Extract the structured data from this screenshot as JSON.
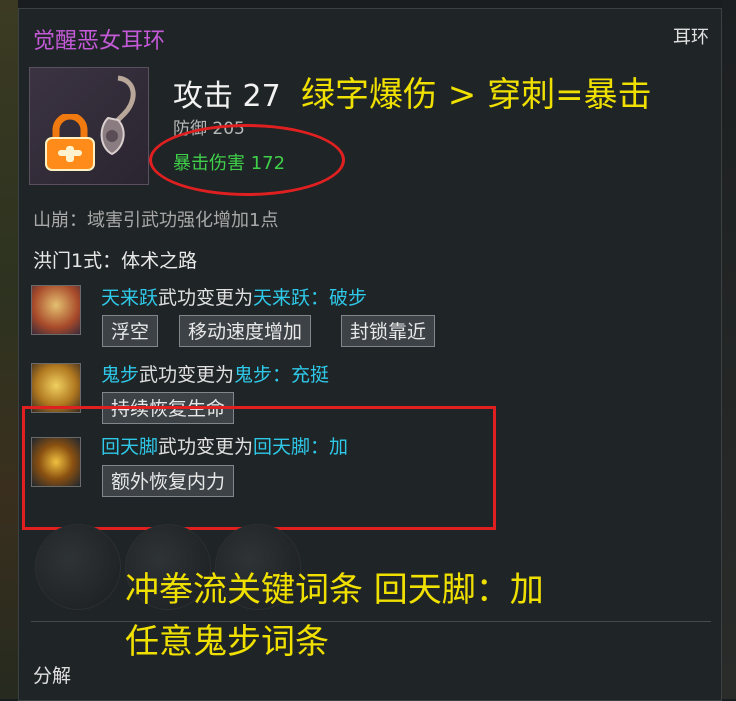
{
  "item": {
    "name": "觉醒恶女耳环",
    "slot": "耳环",
    "attack": "攻击 27",
    "defense": "防御 205",
    "crit_damage": "暴击伤害 172",
    "passive": "山崩：域害引武功强化增加1点",
    "school_style": "洪门1式：体术之路"
  },
  "skills": [
    {
      "name": "天来跃",
      "middle": "武功变更为",
      "changed": "天来跃：破步",
      "tags": [
        "浮空",
        "移动速度增加",
        "封锁靠近"
      ]
    },
    {
      "name": "鬼步",
      "middle": "武功变更为",
      "changed": "鬼步：充挺",
      "tags": [
        "持续恢复生命"
      ]
    },
    {
      "name": "回天脚",
      "middle": "武功变更为",
      "changed": "回天脚：加",
      "tags": [
        "额外恢复内力"
      ]
    }
  ],
  "annotations": {
    "top": "绿字爆伤 > 穿刺=暴击",
    "bottom_line1": "冲拳流关键词条 回天脚：加",
    "bottom_line2": "任意鬼步词条"
  },
  "footer": {
    "disassemble": "分解"
  },
  "colors": {
    "item_name": "#c45ad8",
    "skill_name": "#2ec8e8",
    "crit_green": "#3fd14a",
    "annotation_yellow": "#f0e000",
    "highlight_red": "#e02020"
  }
}
